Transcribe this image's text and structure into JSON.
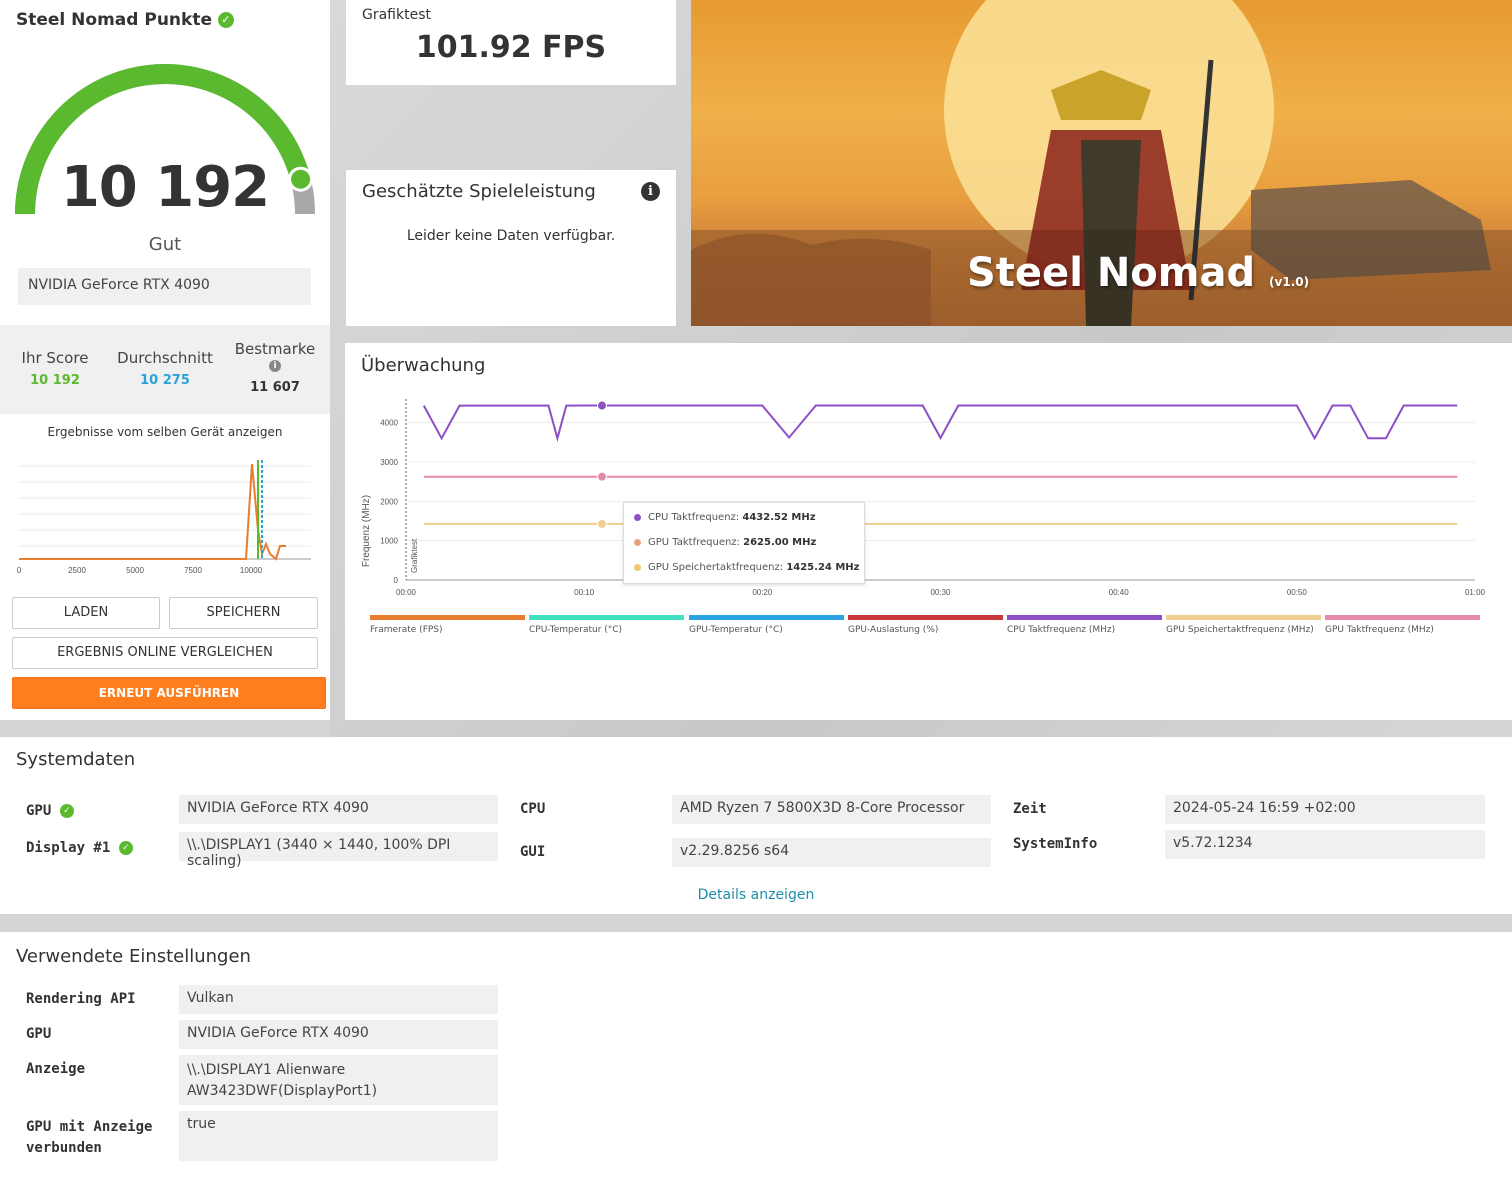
{
  "score": {
    "title": "Steel Nomad Punkte",
    "value": "10 192",
    "rating": "Gut",
    "gpu": "NVIDIA GeForce RTX 4090",
    "gauge_fraction": 0.92
  },
  "stats": {
    "your_score_label": "Ihr Score",
    "your_score": "10 192",
    "average_label": "Durchschnitt",
    "average": "10 275",
    "best_label": "Bestmarke",
    "best": "11 607"
  },
  "results": {
    "label": "Ergebnisse vom selben Gerät anzeigen",
    "x_ticks": [
      "0",
      "2500",
      "5000",
      "7500",
      "10000"
    ],
    "load_label": "LADEN",
    "save_label": "SPEICHERN",
    "compare_label": "ERGEBNIS ONLINE VERGLEICHEN",
    "run_label": "ERNEUT AUSFÜHREN"
  },
  "graphics_test": {
    "label": "Grafiktest",
    "value": "101.92 FPS"
  },
  "estimated_performance": {
    "title": "Geschätzte Spieleleistung",
    "message": "Leider keine Daten verfügbar."
  },
  "banner": {
    "title": "Steel Nomad",
    "version": "(v1.0)"
  },
  "monitoring": {
    "title": "Überwachung",
    "y_axis_label": "Frequenz (MHz)",
    "section_label": "Grafiktest",
    "tooltip": [
      {
        "label": "CPU Taktfrequenz:",
        "value": "4432.52 MHz",
        "color": "#8e4ec6"
      },
      {
        "label": "GPU Taktfrequenz:",
        "value": "2625.00 MHz",
        "color": "#e8a183"
      },
      {
        "label": "GPU Speichertaktfrequenz:",
        "value": "1425.24 MHz",
        "color": "#f0c86e"
      }
    ],
    "legend": [
      {
        "label": "Framerate (FPS)",
        "color": "#e87d30"
      },
      {
        "label": "CPU-Temperatur (°C)",
        "color": "#40e0c0"
      },
      {
        "label": "GPU-Temperatur (°C)",
        "color": "#2aa3e3"
      },
      {
        "label": "GPU-Auslastung (%)",
        "color": "#c8383a"
      },
      {
        "label": "CPU Taktfrequenz (MHz)",
        "color": "#8e4ec6"
      },
      {
        "label": "GPU Speichertaktfrequenz (MHz)",
        "color": "#f0d090"
      },
      {
        "label": "GPU Taktfrequenz (MHz)",
        "color": "#e68aa8"
      }
    ]
  },
  "chart_data": {
    "type": "line",
    "xlabel": "",
    "ylabel": "Frequenz (MHz)",
    "ylim": [
      0,
      4700
    ],
    "xlim": [
      0,
      60
    ],
    "x_ticks": [
      "00:00",
      "00:10",
      "00:20",
      "00:30",
      "00:40",
      "00:50",
      "01:00"
    ],
    "y_ticks": [
      "0",
      "1000",
      "2000",
      "3000",
      "4000"
    ],
    "series": [
      {
        "name": "CPU Taktfrequenz (MHz)",
        "color": "#8e4ec6",
        "x": [
          1,
          2,
          3,
          8,
          8.5,
          9,
          10,
          20,
          21.5,
          23,
          29,
          30,
          31,
          50,
          51,
          52,
          53,
          54,
          54.5,
          55,
          56,
          57,
          59
        ],
        "values": [
          4430,
          3600,
          4430,
          4430,
          3600,
          4430,
          4432,
          4432,
          3620,
          4432,
          4432,
          3610,
          4432,
          4432,
          3600,
          4432,
          4432,
          3600,
          3600,
          3600,
          4432,
          4432,
          4432
        ]
      },
      {
        "name": "GPU Taktfrequenz (MHz)",
        "color": "#e68aa8",
        "x": [
          1,
          59
        ],
        "values": [
          2625,
          2625
        ]
      },
      {
        "name": "GPU Speichertaktfrequenz (MHz)",
        "color": "#f0d090",
        "x": [
          1,
          59
        ],
        "values": [
          1425,
          1425
        ]
      }
    ],
    "highlight_x": 11
  },
  "system": {
    "title": "Systemdaten",
    "gpu_label": "GPU",
    "gpu": "NVIDIA GeForce RTX 4090",
    "display_label": "Display #1",
    "display": "\\\\.\\DISPLAY1 (3440 × 1440, 100% DPI scaling)",
    "cpu_label": "CPU",
    "cpu": "AMD Ryzen 7 5800X3D 8-Core Processor",
    "gui_label": "GUI",
    "gui": "v2.29.8256 s64",
    "time_label": "Zeit",
    "time": "2024-05-24 16:59 +02:00",
    "sysinfo_label": "SystemInfo",
    "sysinfo": "v5.72.1234",
    "details_link": "Details anzeigen"
  },
  "settings": {
    "title": "Verwendete Einstellungen",
    "api_label": "Rendering API",
    "api": "Vulkan",
    "gpu_label": "GPU",
    "gpu": "NVIDIA GeForce RTX 4090",
    "display_label": "Anzeige",
    "display": "\\\\.\\DISPLAY1 Alienware AW3423DWF(DisplayPort1)",
    "connected_label": "GPU mit Anzeige verbunden",
    "connected": "true"
  },
  "colors": {
    "accent_orange": "#fe7e1d",
    "good_green": "#5bb930",
    "average_blue": "#2aa3d8",
    "link_teal": "#1d8fa8"
  }
}
